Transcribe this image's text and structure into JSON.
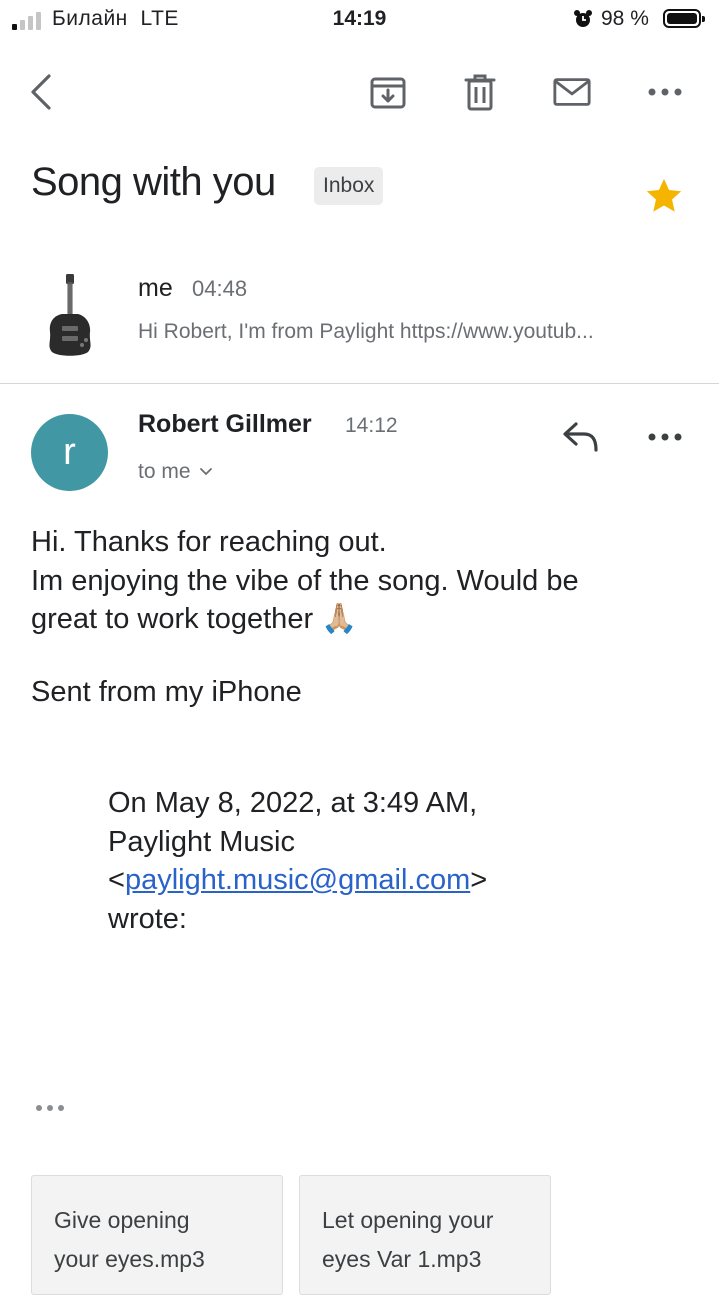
{
  "status_bar": {
    "carrier": "Билайн",
    "network": "LTE",
    "time": "14:19",
    "battery": "98 %"
  },
  "toolbar": {
    "back_icon": "chevron-left-icon",
    "archive_icon": "archive-icon",
    "delete_icon": "trash-icon",
    "mark_unread_icon": "mail-icon",
    "more_icon": "more-horizontal-icon"
  },
  "thread": {
    "subject": "Song with you",
    "label": "Inbox",
    "starred": true,
    "star_color": "#f4b400"
  },
  "collapsed_message": {
    "sender": "me",
    "time": "04:48",
    "snippet": "Hi Robert, I'm from Paylight https://www.youtub..."
  },
  "expanded_message": {
    "avatar_letter": "r",
    "avatar_color": "#4297a4",
    "sender": "Robert Gillmer",
    "time": "14:12",
    "recipients": "to me",
    "body_lines": [
      "Hi. Thanks for reaching out.",
      "Im enjoying the vibe of the song. Would be",
      "great to work together"
    ],
    "emoji": "🙏🏼",
    "signature": "Sent from my iPhone",
    "quote_line1": "On May 8, 2022, at 3:49 AM,",
    "quote_line2": "Paylight Music",
    "quote_email": "paylight.music@gmail.com",
    "quote_line4": "wrote:"
  },
  "attachments": [
    {
      "line1": "Give opening",
      "line2": "your eyes.mp3"
    },
    {
      "line1": "Let opening your",
      "line2": "eyes Var 1.mp3"
    }
  ]
}
